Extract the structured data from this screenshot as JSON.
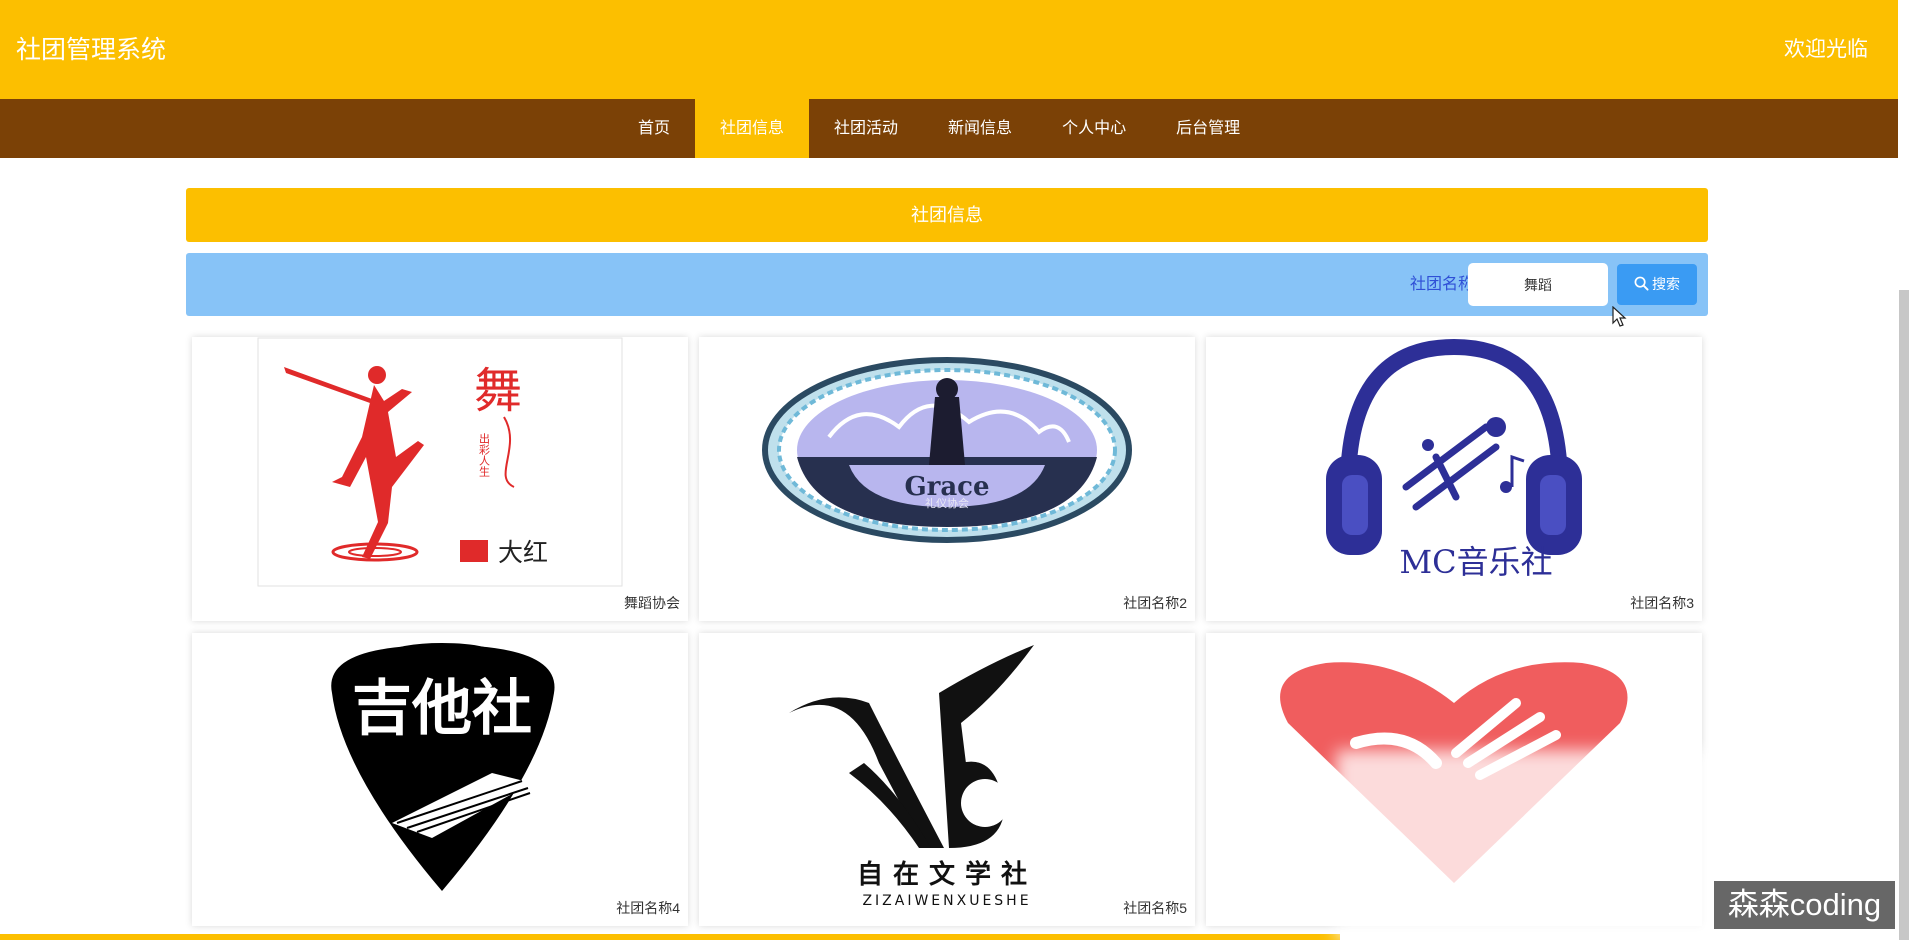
{
  "header": {
    "title": "社团管理系统",
    "welcome": "欢迎光临"
  },
  "nav": [
    {
      "label": "首页",
      "active": false
    },
    {
      "label": "社团信息",
      "active": true
    },
    {
      "label": "社团活动",
      "active": false
    },
    {
      "label": "新闻信息",
      "active": false
    },
    {
      "label": "个人中心",
      "active": false
    },
    {
      "label": "后台管理",
      "active": false
    }
  ],
  "section": {
    "title": "社团信息"
  },
  "search": {
    "label": "社团名称",
    "value": "舞蹈",
    "button": "搜索"
  },
  "cards": [
    {
      "name": "舞蹈协会",
      "image_text": [
        "舞",
        "出彩人生",
        "大红"
      ]
    },
    {
      "name": "社团名称2",
      "image_text": [
        "Grace",
        "礼仪协会"
      ]
    },
    {
      "name": "社团名称3",
      "image_text": [
        "MC音乐社"
      ]
    },
    {
      "name": "社团名称4",
      "image_text": [
        "吉他社"
      ]
    },
    {
      "name": "社团名称5",
      "image_text": [
        "自在文学社",
        "ZIZAIWENXUESHE"
      ]
    },
    {
      "name": "",
      "image_text": []
    }
  ],
  "watermark": "森森coding",
  "colors": {
    "primary": "#fcbf00",
    "nav": "#7b4106",
    "search_bg": "#87c3f7",
    "search_button": "#3a9bf3"
  }
}
